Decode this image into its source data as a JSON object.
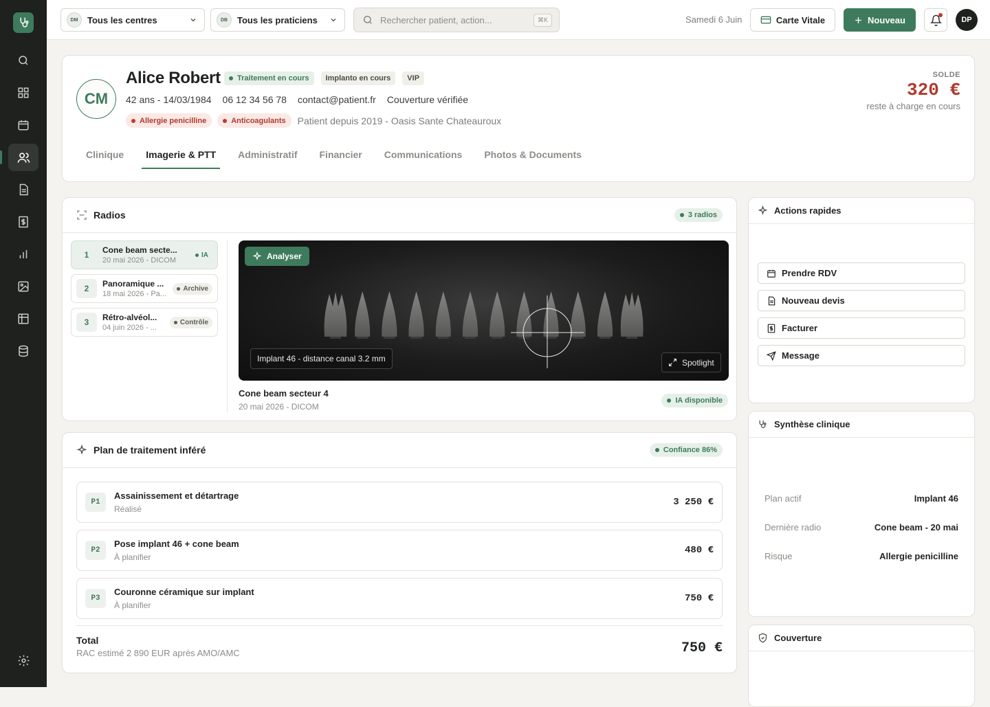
{
  "sidebar": {
    "logo": "tooth-stethoscope-icon",
    "items": [
      {
        "icon": "search-icon"
      },
      {
        "icon": "dashboard-icon"
      },
      {
        "icon": "calendar-icon"
      },
      {
        "icon": "patients-icon",
        "active": true
      },
      {
        "icon": "document-icon"
      },
      {
        "icon": "billing-icon"
      },
      {
        "icon": "chart-icon"
      },
      {
        "icon": "image-icon"
      },
      {
        "icon": "table-icon"
      },
      {
        "icon": "database-icon"
      }
    ],
    "settings": "gear-icon"
  },
  "topbar": {
    "center_select": {
      "initials": "DM",
      "label": "Tous les centres"
    },
    "practitioner_select": {
      "initials": "DB",
      "label": "Tous les praticiens"
    },
    "search": {
      "placeholder": "Rechercher patient, action...",
      "shortcut": "⌘K"
    },
    "date": "Samedi 6 Juin",
    "vitale_label": "Carte Vitale",
    "new_label": "Nouveau",
    "user_initials": "DP"
  },
  "patient": {
    "initials": "CM",
    "name": "Alice Robert",
    "tags": [
      "Traitement en cours",
      "Implanto en cours",
      "VIP"
    ],
    "age_dob": "42 ans - 14/03/1984",
    "phone": "06 12 34 56 78",
    "email": "contact@patient.fr",
    "coverage": "Couverture vérifiée",
    "alerts": [
      "Allergie penicilline",
      "Anticoagulants"
    ],
    "since": "Patient depuis 2019 - Oasis Sante Chateauroux",
    "balance_label": "SOLDE",
    "balance_value": "320 €",
    "balance_sub": "reste à charge en cours",
    "tabs": [
      "Clinique",
      "Imagerie & PTT",
      "Administratif",
      "Financier",
      "Communications",
      "Photos & Documents"
    ],
    "active_tab": "Imagerie & PTT"
  },
  "radios": {
    "title": "Radios",
    "count": "3 radios",
    "list": [
      {
        "num": "1",
        "title": "Cone beam secte...",
        "sub": "20 mai 2026 - DICOM",
        "badge": "IA"
      },
      {
        "num": "2",
        "title": "Panoramique ...",
        "sub": "18 mai 2026 - Pa...",
        "badge": "Archive"
      },
      {
        "num": "3",
        "title": "Rétro-alvéol...",
        "sub": "04 juin 2026 - ...",
        "badge": "Contrôle"
      }
    ],
    "viewer": {
      "analyse_label": "Analyser",
      "caption": "Implant 46 - distance canal 3.2 mm",
      "spotlight_label": "Spotlight",
      "title": "Cone beam secteur 4",
      "subtitle": "20 mai 2026 - DICOM",
      "ia_badge": "IA disponible"
    }
  },
  "plan": {
    "title": "Plan de traitement inféré",
    "confidence": "Confiance 86%",
    "rows": [
      {
        "code": "P1",
        "title": "Assainissement et détartrage",
        "status": "Réalisé",
        "amount": "3 250 €"
      },
      {
        "code": "P2",
        "title": "Pose implant 46 + cone beam",
        "status": "À planifier",
        "amount": "480 €"
      },
      {
        "code": "P3",
        "title": "Couronne céramique sur implant",
        "status": "À planifier",
        "amount": "750 €"
      }
    ],
    "total_label": "Total",
    "total_sub": "RAC estimé 2 890 EUR après AMO/AMC",
    "total_value": "750 €"
  },
  "actions": {
    "title": "Actions rapides",
    "buttons": [
      "Prendre RDV",
      "Nouveau devis",
      "Facturer",
      "Message"
    ]
  },
  "synthese": {
    "title": "Synthèse clinique",
    "rows": [
      {
        "k": "Plan actif",
        "v": "Implant 46"
      },
      {
        "k": "Dernière radio",
        "v": "Cone beam - 20 mai"
      },
      {
        "k": "Risque",
        "v": "Allergie penicilline"
      }
    ]
  },
  "couverture": {
    "title": "Couverture"
  }
}
